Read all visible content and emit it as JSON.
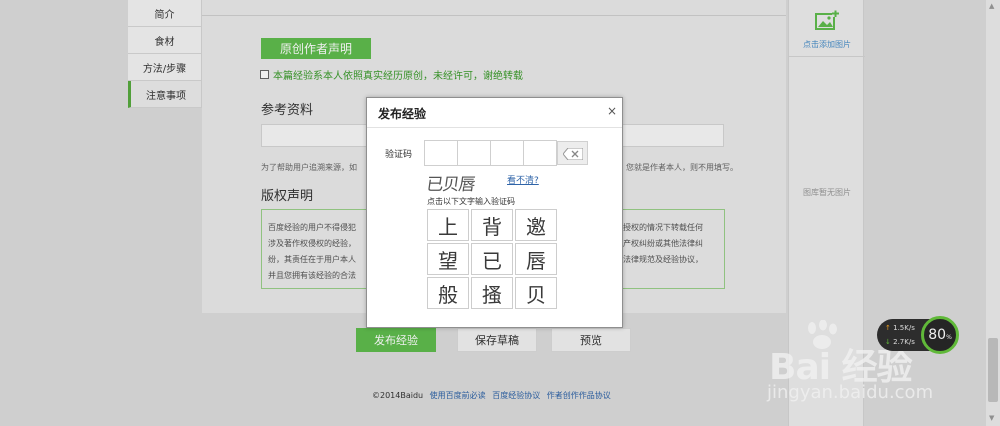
{
  "sidenav": {
    "items": [
      {
        "label": "简介"
      },
      {
        "label": "食材"
      },
      {
        "label": "方法/步骤"
      },
      {
        "label": "注意事项"
      }
    ],
    "active_index": 3
  },
  "editor": {
    "original_badge": "原创作者声明",
    "original_statement": "本篇经验系本人依照真实经历原创，未经许可，谢绝转载",
    "references_heading": "参考资料",
    "references_hint_left": "为了帮助用户追溯来源，如",
    "references_hint_right": "您就是作者本人，则不用填写。",
    "copyright_heading": "版权声明",
    "copyright_lines_left": [
      "百度经验的用户不得侵犯",
      "涉及著作权侵权的经验，",
      "纷，其责任在于用户本人",
      "并且您拥有该经验的合法"
    ],
    "copyright_lines_right": [
      "授权的情况下转载任何",
      "产权纠纷或其他法律纠",
      "法律规范及经验协议，",
      ""
    ]
  },
  "right_panel": {
    "add_image_label": "点击添加图片",
    "no_image_label": "图库暂无图片"
  },
  "actions": {
    "publish": "发布经验",
    "save_draft": "保存草稿",
    "preview": "预览"
  },
  "footer": {
    "copyright": "©2014Baidu",
    "links": [
      "使用百度前必读",
      "百度经验协议",
      "作者创作作品协议"
    ]
  },
  "modal": {
    "title": "发布经验",
    "close": "×",
    "captcha_label": "验证码",
    "captcha_image_text": "已贝唇",
    "unclear_link": "看不清?",
    "instruction": "点击以下文字输入验证码",
    "characters": [
      "上",
      "背",
      "邀",
      "望",
      "已",
      "唇",
      "般",
      "搔",
      "贝"
    ]
  },
  "speed_widget": {
    "upload": "1.5K/s",
    "download": "2.7K/s",
    "percent": "80",
    "percent_unit": "%",
    "ring_color": "#67c53d"
  },
  "watermark": {
    "brand": "Bai 经验",
    "url": "jingyan.baidu.com"
  },
  "colors": {
    "accent_green": "#5fbc4d",
    "link_blue": "#2f64a8"
  }
}
